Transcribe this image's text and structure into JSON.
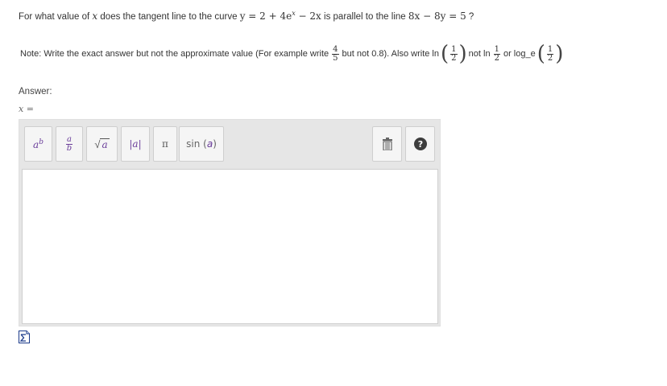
{
  "question": {
    "prefix": "For what value of",
    "var_x": "x",
    "mid1": "does the tangent line to the curve",
    "curve": "y = 2 + 4e",
    "exp": "x",
    "curve_tail": " − 2x",
    "mid2": "is parallel to the line",
    "line_eq": "8x − 8y = 5",
    "suffix": "?"
  },
  "note": {
    "part1": "Note: Write the exact answer but not the approximate value (For example write",
    "frac_num": "4",
    "frac_den": "5",
    "part2": "but not 0.8). Also write ln",
    "ln_num": "1",
    "ln_den": "2",
    "part3": "not ln",
    "ln2_num": "1",
    "ln2_den": "2",
    "part4": "or log_e",
    "loge_num": "1",
    "loge_den": "2"
  },
  "answer": {
    "label": "Answer:",
    "var_prefix": "x ="
  },
  "toolbar": {
    "power": {
      "base": "a",
      "exp": "b"
    },
    "fraction": {
      "num": "a",
      "den": "b"
    },
    "sqrt": {
      "symbol": "√",
      "arg": "a"
    },
    "abs": {
      "text": "|a|"
    },
    "pi": {
      "text": "π"
    },
    "sin": {
      "fn": "sin",
      "arg": "a"
    },
    "trash_icon": "trash-icon",
    "help_icon": "help-icon"
  },
  "input": {
    "value": ""
  },
  "icons": {
    "sigma": "sigma-icon"
  },
  "colors": {
    "accent": "#6a3d9a",
    "toolbar_bg": "#e6e6e6",
    "text": "#333333"
  }
}
